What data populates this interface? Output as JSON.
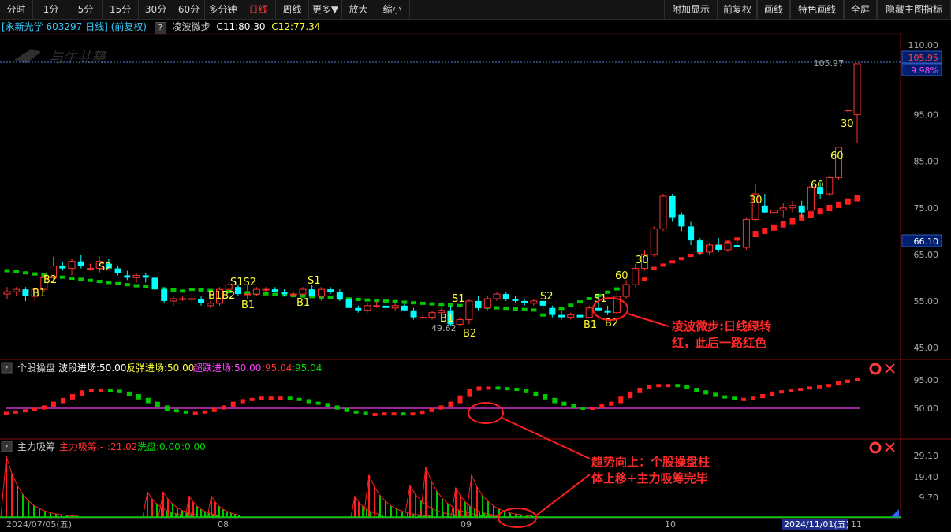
{
  "toolbar": {
    "left": [
      {
        "label": "分时",
        "w": 42
      },
      {
        "label": "1分",
        "w": 46
      },
      {
        "label": "5分",
        "w": 42
      },
      {
        "label": "15分",
        "w": 46
      },
      {
        "label": "30分",
        "w": 44
      },
      {
        "label": "60分",
        "w": 40
      },
      {
        "label": "多分钟",
        "w": 46
      },
      {
        "label": "日线",
        "w": 44,
        "active": true
      },
      {
        "label": "周线",
        "w": 42
      },
      {
        "label": "更多▼",
        "w": 42
      },
      {
        "label": "放大",
        "w": 42
      },
      {
        "label": "缩小",
        "w": 44
      }
    ],
    "right": [
      {
        "label": "附加显示",
        "w": 68
      },
      {
        "label": "前复权",
        "w": 50
      },
      {
        "label": "画线",
        "w": 42
      },
      {
        "label": "特色画线",
        "w": 68
      },
      {
        "label": "全屏",
        "w": 42
      },
      {
        "label": "隐藏主图指标",
        "w": 94
      }
    ]
  },
  "info": {
    "stock": "[永新光学 603297 日线] (前复权)",
    "indicator": "凌波微步",
    "c1": "C11:80.30",
    "c2": "C12:77.34"
  },
  "watermark": "与牛共舞",
  "price_axis": {
    "ticks": [
      "110.00",
      "95.00",
      "85.00",
      "75.00",
      "65.00",
      "55.00",
      "45.00"
    ],
    "current_price": "105.95",
    "current_pct": "9.98%",
    "left_price": "105.97",
    "crosshair_price": "66.10",
    "low_label": "49.62"
  },
  "signals": {
    "b1": "B1",
    "b2": "B2",
    "s1": "S1",
    "s2": "S2",
    "s1s2": "S1S2",
    "b1b2": "B1B2",
    "n30": "30",
    "n60": "60"
  },
  "annotations": {
    "a1_line1": "凌波微步:日线绿转",
    "a1_line2": "红，此后一路红色",
    "a2_line1": "趋势向上：个股操盘柱",
    "a2_line2": "体上移+主力吸筹完毕"
  },
  "panel2": {
    "name": "个股操盘",
    "l1": "波段进场:50.00",
    "l2": "反弹进场:50.00",
    "l3": "超跌进场:50.00",
    "l4": ":95.04",
    "l5": ":95.04",
    "ticks": [
      "95.00",
      "50.00"
    ]
  },
  "panel3": {
    "name": "主力吸筹",
    "l1": "主力吸筹:-",
    "l2": ":21.02",
    "l3": "洗盘:0.00",
    "l4": ":0.00",
    "ticks": [
      "29.10",
      "19.40",
      "9.70"
    ]
  },
  "xaxis": {
    "start": "2024/07/05(五)",
    "m08": "08",
    "m09": "09",
    "m10": "10",
    "m11": "11",
    "cursor": "2024/11/01(五)"
  },
  "colors": {
    "up": "#ff3232",
    "down": "#00ffff",
    "green": "#00c800",
    "red": "#ff1e1e",
    "yellow": "#ffff33",
    "accent": "#ff3b3b"
  },
  "chart_data": {
    "type": "candlestick",
    "ylim": [
      45,
      110
    ],
    "candles": [
      [
        56.5,
        58,
        55.5,
        57
      ],
      [
        57,
        58,
        56,
        57.5
      ],
      [
        57.5,
        58,
        55,
        56
      ],
      [
        56,
        57.5,
        55,
        57.5
      ],
      [
        57.5,
        61,
        57,
        60
      ],
      [
        60,
        64.5,
        59,
        62.5
      ],
      [
        62.5,
        63.5,
        61.5,
        62
      ],
      [
        62,
        64,
        60.5,
        63.5
      ],
      [
        63.5,
        65,
        62,
        62.5
      ],
      [
        62,
        63,
        61.5,
        62
      ],
      [
        62,
        64.5,
        61,
        63.5
      ],
      [
        63,
        64,
        62,
        62
      ],
      [
        62,
        62.5,
        60.5,
        61
      ],
      [
        60.5,
        61.5,
        59.5,
        60
      ],
      [
        60,
        61,
        59,
        60.5
      ],
      [
        60.5,
        61,
        59,
        60
      ],
      [
        60,
        60.5,
        57,
        57.5
      ],
      [
        57.5,
        58,
        54.5,
        55
      ],
      [
        55,
        56,
        54,
        55.5
      ],
      [
        55.5,
        56,
        55,
        55.5
      ],
      [
        55.5,
        56.5,
        54.5,
        55.5
      ],
      [
        55.5,
        56,
        54,
        54.5
      ],
      [
        54,
        55,
        53.5,
        54.5
      ],
      [
        54.5,
        58,
        54,
        57.5
      ],
      [
        57.5,
        59,
        57,
        58.5
      ],
      [
        58,
        58.5,
        56,
        56.5
      ],
      [
        56.5,
        58.5,
        55.5,
        56.5
      ],
      [
        56.5,
        58,
        56,
        57.5
      ],
      [
        57.5,
        58,
        57,
        57.5
      ],
      [
        57.5,
        58,
        57,
        57
      ],
      [
        57,
        57.5,
        56,
        56.5
      ],
      [
        56.5,
        57,
        56,
        56.5
      ],
      [
        56.5,
        58,
        56,
        57.5
      ],
      [
        57.5,
        58.5,
        56,
        56
      ],
      [
        56,
        58,
        55,
        57.5
      ],
      [
        57.5,
        58,
        56.5,
        57
      ],
      [
        57,
        57.5,
        55,
        55.5
      ],
      [
        55.5,
        56,
        53,
        53.5
      ],
      [
        53.5,
        54,
        52.5,
        53
      ],
      [
        53,
        54.5,
        52.5,
        54
      ],
      [
        54,
        55,
        53.5,
        54
      ],
      [
        54,
        54.5,
        53,
        53.5
      ],
      [
        53.5,
        54.5,
        53,
        54
      ],
      [
        54,
        54.5,
        53,
        53
      ],
      [
        53,
        53.5,
        51,
        51.5
      ],
      [
        51.5,
        52,
        51,
        51.5
      ],
      [
        51.5,
        53,
        51,
        52.5
      ],
      [
        52.5,
        53.5,
        52,
        53
      ],
      [
        53,
        54,
        49.62,
        50
      ],
      [
        50,
        51.5,
        49.7,
        51
      ],
      [
        51,
        55.5,
        50,
        55
      ],
      [
        55,
        56,
        53,
        53.5
      ],
      [
        53.5,
        56,
        53,
        55.5
      ],
      [
        55.5,
        57,
        55,
        56.5
      ],
      [
        56.5,
        57,
        55,
        55.5
      ],
      [
        55.5,
        56,
        54.5,
        55
      ],
      [
        55,
        55.5,
        54,
        54.5
      ],
      [
        54.5,
        55.5,
        54,
        55
      ],
      [
        55,
        55.5,
        53.5,
        54
      ],
      [
        53.5,
        54,
        51.5,
        52
      ],
      [
        52,
        53,
        51,
        51.5
      ],
      [
        51.5,
        52.5,
        51,
        52
      ],
      [
        52,
        53,
        51,
        51.5
      ],
      [
        51.5,
        54,
        51.5,
        53.5
      ],
      [
        53.5,
        56,
        53,
        53
      ],
      [
        53,
        54,
        52,
        52.5
      ],
      [
        52.5,
        57,
        52,
        56
      ],
      [
        56,
        59.5,
        55.5,
        58.5
      ],
      [
        58.5,
        63,
        58,
        62
      ],
      [
        62,
        66,
        61.5,
        65
      ],
      [
        65,
        71,
        64.5,
        70.5
      ],
      [
        70.5,
        78,
        70,
        77.5
      ],
      [
        77.5,
        78,
        72,
        73
      ],
      [
        73.5,
        74,
        70,
        71
      ],
      [
        71,
        72,
        67,
        68
      ],
      [
        68,
        68.5,
        65,
        65.5
      ],
      [
        65.5,
        67.5,
        65,
        67
      ],
      [
        67,
        68.5,
        65.5,
        66
      ],
      [
        66,
        68,
        65.5,
        67.5
      ],
      [
        67,
        68.5,
        66,
        66.5
      ],
      [
        66.5,
        73,
        66,
        72.5
      ],
      [
        72.5,
        80,
        72,
        78
      ],
      [
        75.5,
        78,
        74,
        74
      ],
      [
        74,
        79,
        73.5,
        74.5
      ],
      [
        74.5,
        76,
        73,
        75
      ],
      [
        75,
        76.5,
        74,
        75.5
      ],
      [
        75.5,
        76.5,
        73,
        74
      ],
      [
        74.5,
        80,
        74,
        79.5
      ],
      [
        79.5,
        80.5,
        77,
        78
      ],
      [
        78,
        82,
        77.5,
        81.5
      ],
      [
        81.5,
        88,
        81,
        88
      ],
      [
        96,
        96.5,
        95.5,
        96
      ],
      [
        95,
        105.97,
        89,
        105.95
      ]
    ]
  }
}
